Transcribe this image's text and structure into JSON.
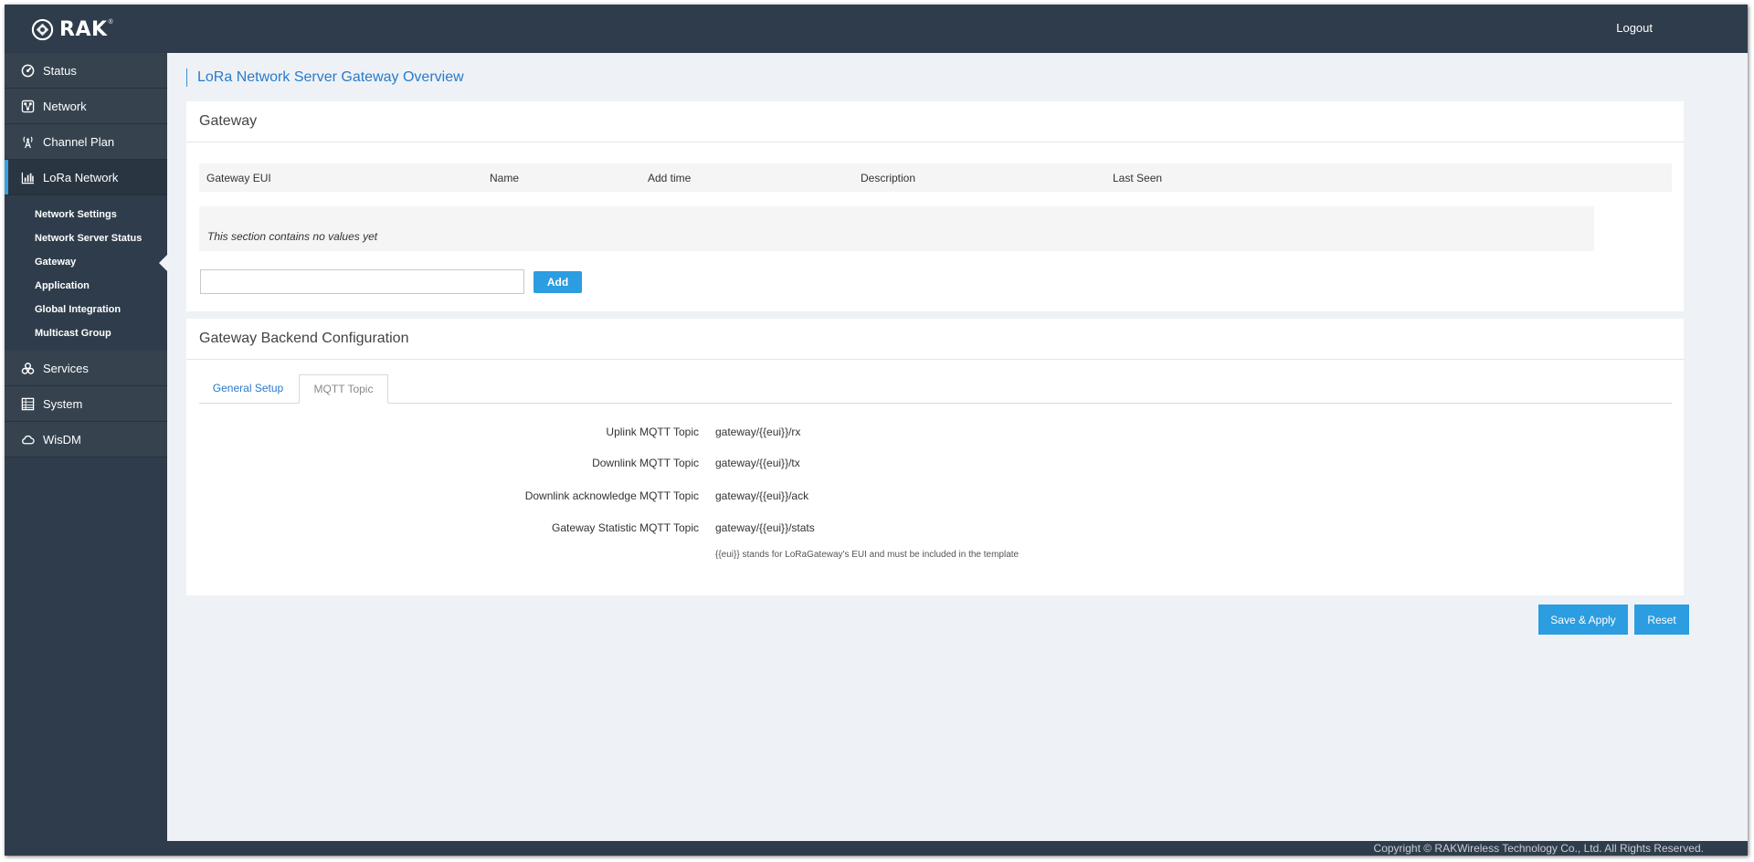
{
  "header": {
    "brand": "RAK",
    "brand_mark": "®",
    "logout_label": "Logout"
  },
  "sidebar": {
    "items": [
      {
        "label": "Status",
        "icon": "status-icon"
      },
      {
        "label": "Network",
        "icon": "network-icon"
      },
      {
        "label": "Channel Plan",
        "icon": "antenna-icon"
      },
      {
        "label": "LoRa Network",
        "icon": "bar-chart-icon"
      },
      {
        "label": "Services",
        "icon": "services-icon"
      },
      {
        "label": "System",
        "icon": "system-icon"
      },
      {
        "label": "WisDM",
        "icon": "cloud-icon"
      }
    ],
    "subitems": [
      {
        "label": "Network Settings"
      },
      {
        "label": "Network Server Status"
      },
      {
        "label": "Gateway"
      },
      {
        "label": "Application"
      },
      {
        "label": "Global Integration"
      },
      {
        "label": "Multicast Group"
      }
    ],
    "active_item": "LoRa Network",
    "current_subitem": "Gateway"
  },
  "page": {
    "title": "LoRa Network Server Gateway Overview"
  },
  "gateway_panel": {
    "title": "Gateway",
    "columns": [
      "Gateway EUI",
      "Name",
      "Add time",
      "Description",
      "Last Seen"
    ],
    "empty_text": "This section contains no values yet",
    "input_value": "",
    "add_label": "Add"
  },
  "backend_panel": {
    "title": "Gateway Backend Configuration",
    "tabs": [
      {
        "label": "General Setup"
      },
      {
        "label": "MQTT Topic"
      }
    ],
    "active_tab": "MQTT Topic",
    "fields": [
      {
        "label": "Uplink MQTT Topic",
        "value": "gateway/{{eui}}/rx"
      },
      {
        "label": "Downlink MQTT Topic",
        "value": "gateway/{{eui}}/tx"
      },
      {
        "label": "Downlink acknowledge MQTT Topic",
        "value": "gateway/{{eui}}/ack"
      },
      {
        "label": "Gateway Statistic MQTT Topic",
        "value": "gateway/{{eui}}/stats"
      }
    ],
    "hint": "{{eui}} stands for LoRaGateway's EUI and must be included in the template"
  },
  "actions": {
    "save_label": "Save & Apply",
    "reset_label": "Reset"
  },
  "footer": {
    "copyright": "Copyright © RAKWireless Technology Co., Ltd. All Rights Reserved."
  },
  "colors": {
    "sidebar_bg": "#2f3c4b",
    "accent": "#2b9de0",
    "link": "#2a7ac9",
    "content_bg": "#eef2f6"
  }
}
